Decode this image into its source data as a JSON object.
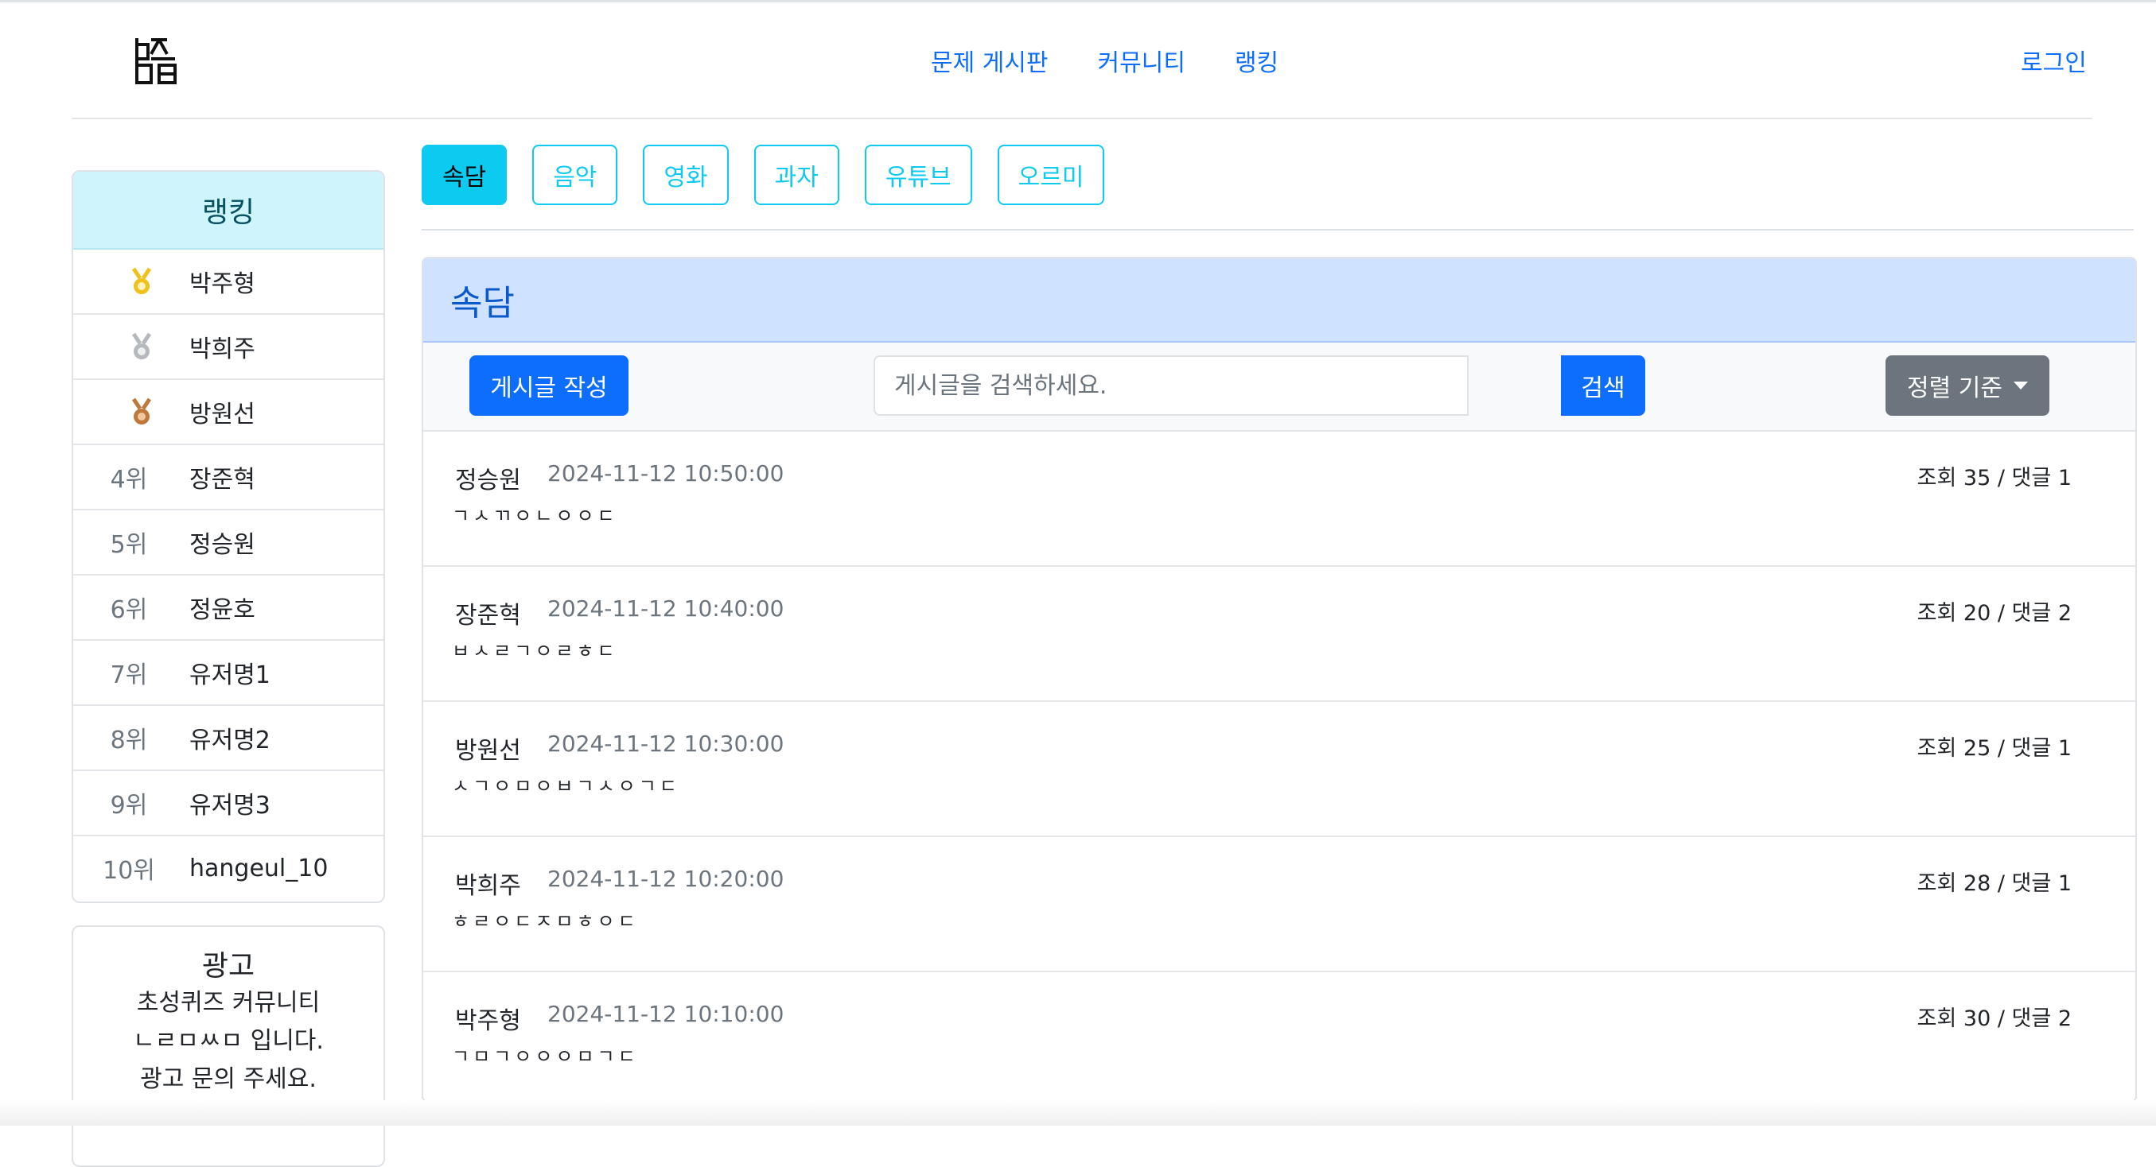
{
  "header": {
    "logo_icon": "chosung-logo-icon",
    "nav": [
      "문제 게시판",
      "커뮤니티",
      "랭킹"
    ],
    "login": "로그인"
  },
  "ranking": {
    "title": "랭킹",
    "rows": [
      {
        "rank": "",
        "medal": "gold-medal-icon",
        "name": "박주형"
      },
      {
        "rank": "",
        "medal": "silver-medal-icon",
        "name": "박희주"
      },
      {
        "rank": "",
        "medal": "bronze-medal-icon",
        "name": "방원선"
      },
      {
        "rank": "4위",
        "name": "장준혁"
      },
      {
        "rank": "5위",
        "name": "정승원"
      },
      {
        "rank": "6위",
        "name": "정윤호"
      },
      {
        "rank": "7위",
        "name": "유저명1"
      },
      {
        "rank": "8위",
        "name": "유저명2"
      },
      {
        "rank": "9위",
        "name": "유저명3"
      },
      {
        "rank": "10위",
        "name": "hangeul_10"
      }
    ]
  },
  "ad": {
    "title": "광고",
    "lines": [
      "초성퀴즈 커뮤니티",
      "ㄴㄹㅁㅆㅁ 입니다.",
      "광고 문의 주세요."
    ]
  },
  "categories": {
    "items": [
      "속담",
      "음악",
      "영화",
      "과자",
      "유튜브",
      "오르미"
    ],
    "active": "속담"
  },
  "board": {
    "title": "속담",
    "write_label": "게시글 작성",
    "search_placeholder": "게시글을 검색하세요.",
    "search_label": "검색",
    "sort_label": "정렬 기준"
  },
  "posts": [
    {
      "author": "정승원",
      "date": "2024-11-12 10:50:00",
      "title": "ㄱㅅㄲㅇㄴㅇㅇㄷ",
      "stats": "조회 35 / 댓글 1"
    },
    {
      "author": "장준혁",
      "date": "2024-11-12 10:40:00",
      "title": "ㅂㅅㄹㄱㅇㄹㅎㄷ",
      "stats": "조회 20 / 댓글 2"
    },
    {
      "author": "방원선",
      "date": "2024-11-12 10:30:00",
      "title": "ㅅㄱㅇㅁㅇㅂㄱㅅㅇㄱㄷ",
      "stats": "조회 25 / 댓글 1"
    },
    {
      "author": "박희주",
      "date": "2024-11-12 10:20:00",
      "title": "ㅎㄹㅇㄷㅈㅁㅎㅇㄷ",
      "stats": "조회 28 / 댓글 1"
    },
    {
      "author": "박주형",
      "date": "2024-11-12 10:10:00",
      "title": "ㄱㅁㄱㅇㅇㅇㅁㄱㄷ",
      "stats": "조회 30 / 댓글 2"
    }
  ],
  "colors": {
    "primary": "#0d6efd",
    "info": "#0dcaf0",
    "secondary": "#6c757d",
    "gold": "#f2c01b",
    "silver": "#b5b8bd",
    "bronze": "#c0773a"
  }
}
